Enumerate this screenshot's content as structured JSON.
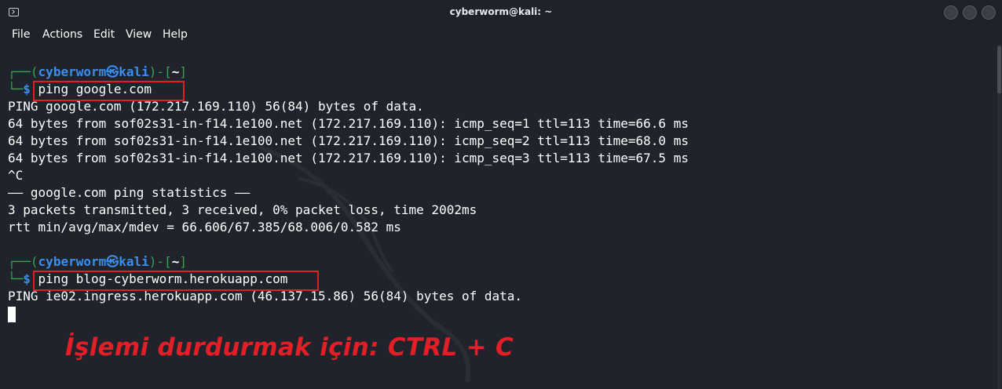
{
  "window": {
    "title": "cyberworm@kali: ~"
  },
  "menu": {
    "items": [
      "File",
      "Actions",
      "Edit",
      "View",
      "Help"
    ]
  },
  "prompt1": {
    "corner": "┌──",
    "open": "(",
    "user": "cyberworm",
    "skull": "㉿",
    "host": "kali",
    "close": ")-[",
    "dir": "~",
    "end": "]",
    "corner2": "└─",
    "dollar": "$",
    "command": " ping google.com"
  },
  "output1": [
    "PING google.com (172.217.169.110) 56(84) bytes of data.",
    "64 bytes from sof02s31-in-f14.1e100.net (172.217.169.110): icmp_seq=1 ttl=113 time=66.6 ms",
    "64 bytes from sof02s31-in-f14.1e100.net (172.217.169.110): icmp_seq=2 ttl=113 time=68.0 ms",
    "64 bytes from sof02s31-in-f14.1e100.net (172.217.169.110): icmp_seq=3 ttl=113 time=67.5 ms",
    "^C",
    "—— google.com ping statistics ——",
    "3 packets transmitted, 3 received, 0% packet loss, time 2002ms",
    "rtt min/avg/max/mdev = 66.606/67.385/68.006/0.582 ms"
  ],
  "prompt2": {
    "corner": "┌──",
    "open": "(",
    "user": "cyberworm",
    "skull": "㉿",
    "host": "kali",
    "close": ")-[",
    "dir": "~",
    "end": "]",
    "corner2": "└─",
    "dollar": "$",
    "command": " ping blog-cyberworm.herokuapp.com"
  },
  "output2": [
    "PING ie02.ingress.herokuapp.com (46.137.15.86) 56(84) bytes of data."
  ],
  "caption": "İşlemi durdurmak için: CTRL + C",
  "colors": {
    "prompt_blue": "#3b8eea",
    "prompt_green": "#2fa84f",
    "highlight_red": "#e02020",
    "caption_red": "#e21f26"
  }
}
